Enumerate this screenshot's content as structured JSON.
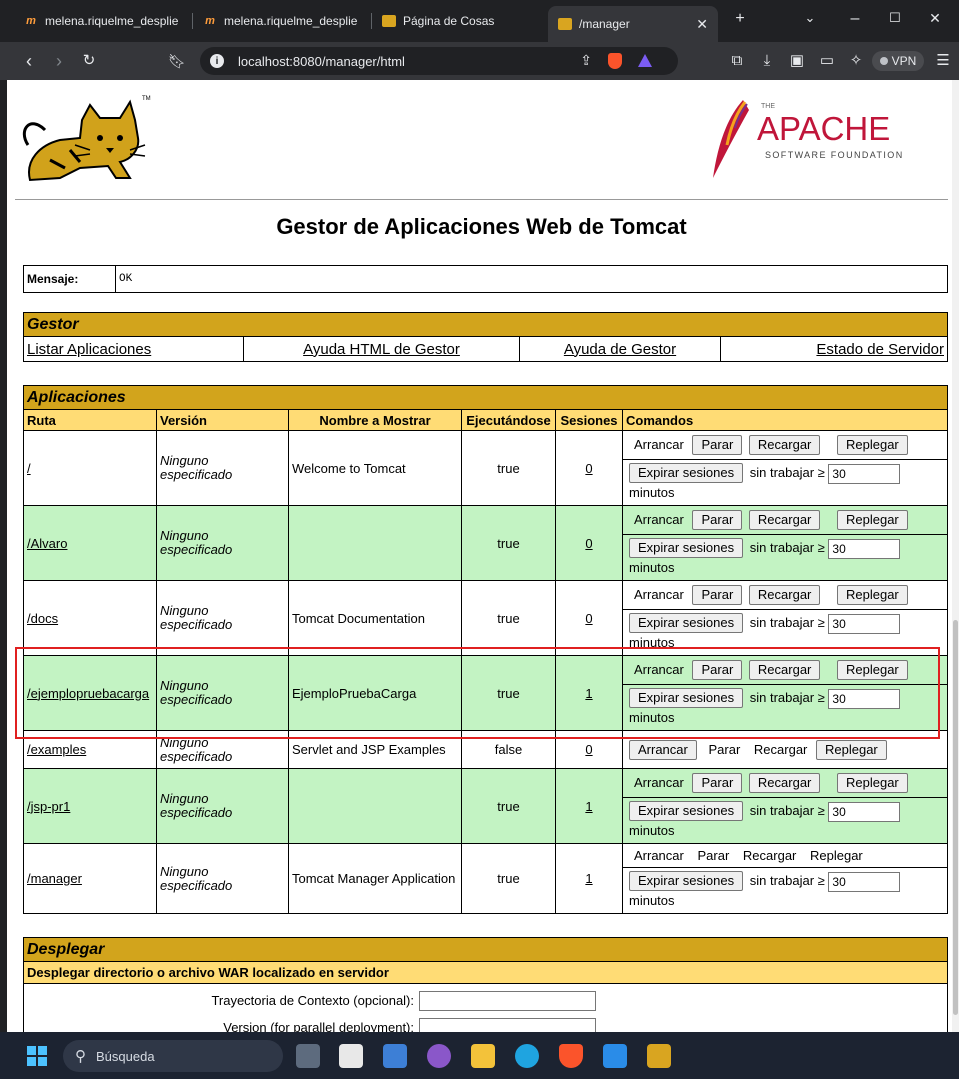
{
  "browser": {
    "tabs": [
      {
        "title": "melena.riquelme_desplie",
        "favicon": "moodle-icon"
      },
      {
        "title": "melena.riquelme_desplie",
        "favicon": "moodle-icon"
      },
      {
        "title": "Página de Cosas",
        "favicon": "tomcat-icon"
      },
      {
        "title": "/manager",
        "favicon": "tomcat-icon",
        "active": true
      }
    ],
    "url": "localhost:8080/manager/html",
    "vpn_label": "VPN"
  },
  "page": {
    "title": "Gestor de Aplicaciones Web de Tomcat",
    "apache_logo": {
      "the": "THE",
      "name": "APACHE",
      "sub": "SOFTWARE FOUNDATION"
    },
    "message": {
      "label": "Mensaje:",
      "value": "OK"
    },
    "gestor": {
      "title": "Gestor",
      "links": [
        "Listar Aplicaciones",
        "Ayuda HTML de Gestor",
        "Ayuda de Gestor",
        "Estado de Servidor"
      ]
    },
    "apps": {
      "title": "Aplicaciones",
      "headers": [
        "Ruta",
        "Versión",
        "Nombre a Mostrar",
        "Ejecutándose",
        "Sesiones",
        "Comandos"
      ],
      "version_text": [
        "Ninguno",
        "especificado"
      ],
      "commands": {
        "start": "Arrancar",
        "stop": "Parar",
        "reload": "Recargar",
        "undeploy": "Replegar",
        "expire": "Expirar sesiones",
        "idle": "sin trabajar ≥",
        "idle_value": "30",
        "minutes": "minutos"
      },
      "rows": [
        {
          "path": "/",
          "name": "Welcome to Tomcat",
          "running": "true",
          "sessions": "0"
        },
        {
          "path": "/Alvaro",
          "name": "",
          "running": "true",
          "sessions": "0"
        },
        {
          "path": "/docs",
          "name": "Tomcat Documentation",
          "running": "true",
          "sessions": "0"
        },
        {
          "path": "/ejemplopruebacarga",
          "name": "EjemploPruebaCarga",
          "running": "true",
          "sessions": "1"
        },
        {
          "path": "/examples",
          "name": "Servlet and JSP Examples",
          "running": "false",
          "sessions": "0"
        },
        {
          "path": "/jsp-pr1",
          "name": "",
          "running": "true",
          "sessions": "1"
        },
        {
          "path": "/manager",
          "name": "Tomcat Manager Application",
          "running": "true",
          "sessions": "1"
        }
      ]
    },
    "deploy": {
      "title": "Desplegar",
      "subtitle": "Desplegar directorio o archivo WAR localizado en servidor",
      "context_label": "Trayectoria de Contexto (opcional):",
      "version_label": "Version (for parallel deployment):"
    }
  },
  "taskbar": {
    "search_placeholder": "Búsqueda"
  },
  "colors": {
    "section": "#d2a41c",
    "subhead": "#ffdc75",
    "green_row": "#c3f3c3",
    "highlight": "#e02020"
  }
}
